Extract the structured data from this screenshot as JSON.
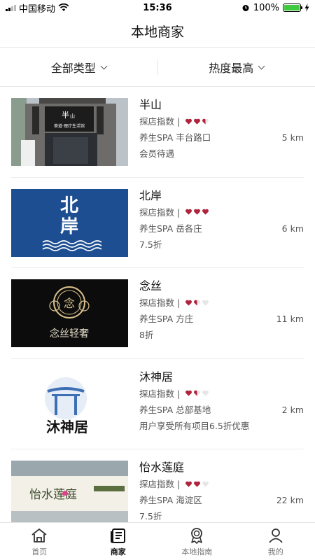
{
  "status_bar": {
    "carrier": "中国移动",
    "time": "15:36",
    "battery": "100%"
  },
  "header": {
    "title": "本地商家"
  },
  "filters": {
    "type_label": "全部类型",
    "sort_label": "热度最高"
  },
  "rating_prefix": "探店指数 |",
  "merchants": [
    {
      "name": "半山",
      "category": "养生SPA",
      "location": "丰台路口",
      "distance": "5 km",
      "promo": "会员待遇",
      "rating": 2.5
    },
    {
      "name": "北岸",
      "category": "养生SPA",
      "location": "岳各庄",
      "distance": "6 km",
      "promo": "7.5折",
      "rating": 3
    },
    {
      "name": "念丝",
      "category": "养生SPA",
      "location": "方庄",
      "distance": "11 km",
      "promo": "8折",
      "rating": 1.5
    },
    {
      "name": "沐神居",
      "category": "养生SPA",
      "location": "总部基地",
      "distance": "2 km",
      "promo": "用户享受所有项目6.5折优惠",
      "rating": 1.5
    },
    {
      "name": "怡水莲庭",
      "category": "养生SPA",
      "location": "海淀区",
      "distance": "22 km",
      "promo": "7.5折",
      "rating": 2
    }
  ],
  "thumb_text": {
    "banshan_sign": "茶道·理疗生活馆",
    "beian": "北岸",
    "niansi": "念丝轻奢",
    "mushenju": "沐神居",
    "yishui": "怡水莲庭"
  },
  "tabs": [
    {
      "label": "首页",
      "icon": "home-icon"
    },
    {
      "label": "商家",
      "icon": "shop-icon"
    },
    {
      "label": "本地指南",
      "icon": "guide-icon"
    },
    {
      "label": "我的",
      "icon": "user-icon"
    }
  ],
  "colors": {
    "heart": "#b0233b",
    "heart_empty": "#e6e6e6",
    "beian_bg": "#1d4e91"
  }
}
